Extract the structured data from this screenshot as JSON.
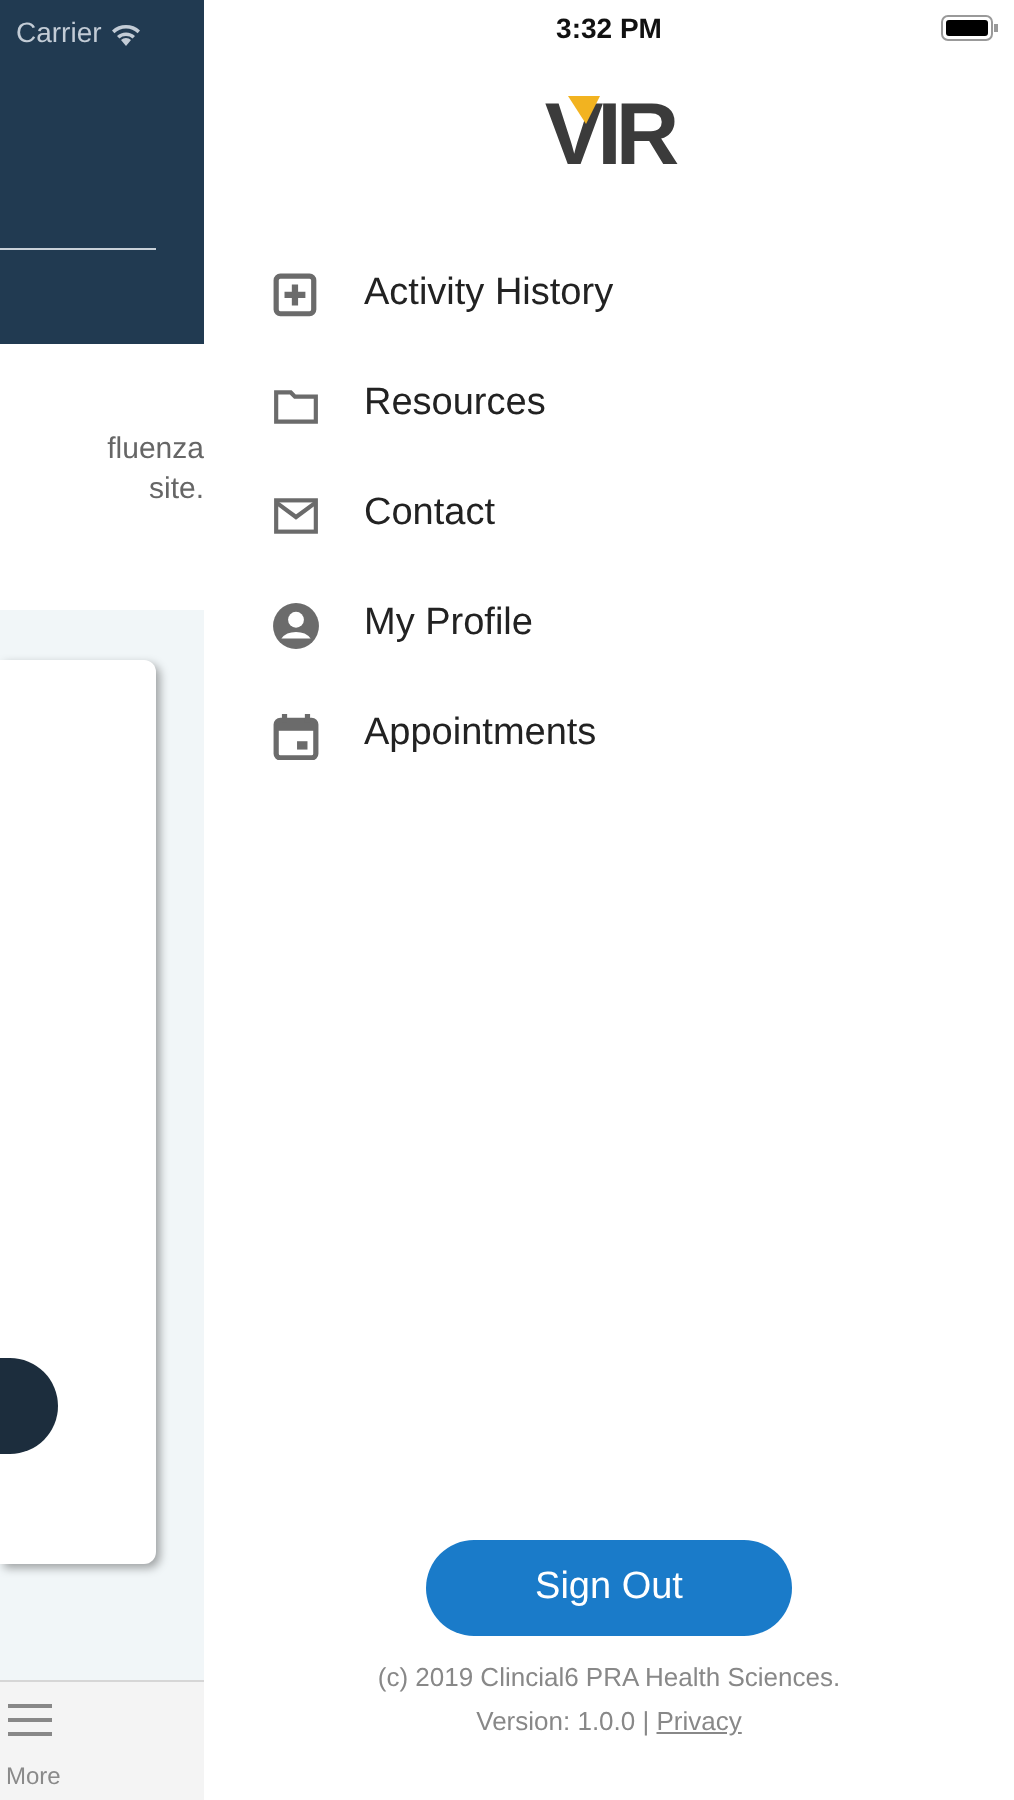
{
  "background_app": {
    "carrier": "Carrier",
    "body_text_lines": [
      "fluenza",
      "site."
    ],
    "tab_bar": {
      "more_label": "More"
    }
  },
  "status_bar": {
    "time": "3:32 PM"
  },
  "logo": {
    "text": "VIR"
  },
  "menu": [
    {
      "kind": "history",
      "label": "Activity History"
    },
    {
      "kind": "folder",
      "label": "Resources"
    },
    {
      "kind": "mail",
      "label": "Contact"
    },
    {
      "kind": "profile",
      "label": "My Profile"
    },
    {
      "kind": "calendar",
      "label": "Appointments"
    }
  ],
  "sign_out": {
    "label": "Sign Out"
  },
  "footer": {
    "copyright": "(c) 2019 Clincial6 PRA Health Sciences.",
    "version": "Version: 1.0.0 |",
    "privacy_link": "Privacy"
  }
}
